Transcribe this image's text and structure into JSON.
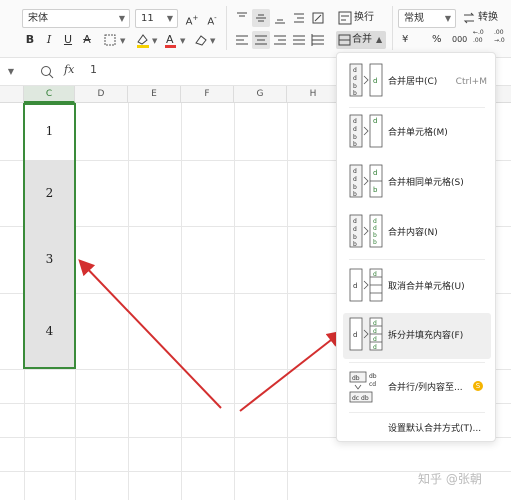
{
  "toolbar": {
    "font_name": "宋体",
    "font_size": "11",
    "number_format": "常规",
    "wrap_label": "换行",
    "merge_label": "合并",
    "convert_label": "转换",
    "currency_symbol": "¥",
    "percent_symbol": "%",
    "thousands_symbol": "000",
    "decimal_increase": "←.0 .00",
    "decimal_decrease": ".00 →.0"
  },
  "formula_bar": {
    "value": "1"
  },
  "grid": {
    "columns": [
      "C",
      "D",
      "E",
      "F",
      "G",
      "H"
    ],
    "active_column": "C",
    "cells": [
      "1",
      "2",
      "3",
      "4"
    ]
  },
  "merge_menu": {
    "items": [
      {
        "label": "合并居中(C)",
        "shortcut": "Ctrl+M"
      },
      {
        "label": "合并单元格(M)",
        "shortcut": ""
      },
      {
        "label": "合并相同单元格(S)",
        "shortcut": ""
      },
      {
        "label": "合并内容(N)",
        "shortcut": ""
      },
      {
        "label": "取消合并单元格(U)",
        "shortcut": ""
      },
      {
        "label": "拆分并填充内容(F)",
        "shortcut": ""
      },
      {
        "label": "合并行/列内容至...",
        "shortcut": ""
      },
      {
        "label": "设置默认合并方式(T)...",
        "shortcut": ""
      }
    ]
  },
  "watermark": "知乎 @张朝",
  "colors": {
    "selection_border": "#3a8b3a",
    "arrow": "#d32f2f",
    "menu_highlight": "#efefef"
  }
}
